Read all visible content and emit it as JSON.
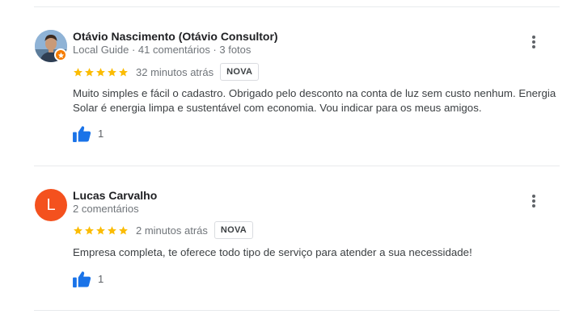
{
  "colors": {
    "star": "#fbbc04",
    "thumb": "#1a73e8",
    "avatar_letter_bg": "#f4511e",
    "local_guide_badge": "#f57c00"
  },
  "reviews": [
    {
      "author_name": "Otávio Nascimento (Otávio Consultor)",
      "author_meta": "Local Guide · 41 comentários · 3 fotos",
      "avatar_type": "photo",
      "avatar_letter": "",
      "local_guide_badge_icon": "star-icon",
      "rating": 5,
      "time": "32 minutos atrás",
      "badge": "NOVA",
      "text_line_1": "Muito simples e fácil o cadastro. Obrigado pelo desconto na conta de luz sem custo nenhum. Energia",
      "text_line_2": "Solar é energia limpa e sustentável com economia. Vou indicar para os meus amigos.",
      "likes": "1",
      "like_icon": "thumbs-up-icon",
      "menu_icon": "more-vert-icon"
    },
    {
      "author_name": "Lucas Carvalho",
      "author_meta": "2 comentários",
      "avatar_type": "letter",
      "avatar_letter": "L",
      "rating": 5,
      "time": "2 minutos atrás",
      "badge": "NOVA",
      "text_line_1": "Empresa completa, te oferece todo tipo de serviço para atender a sua necessidade!",
      "likes": "1",
      "like_icon": "thumbs-up-icon",
      "menu_icon": "more-vert-icon"
    }
  ]
}
